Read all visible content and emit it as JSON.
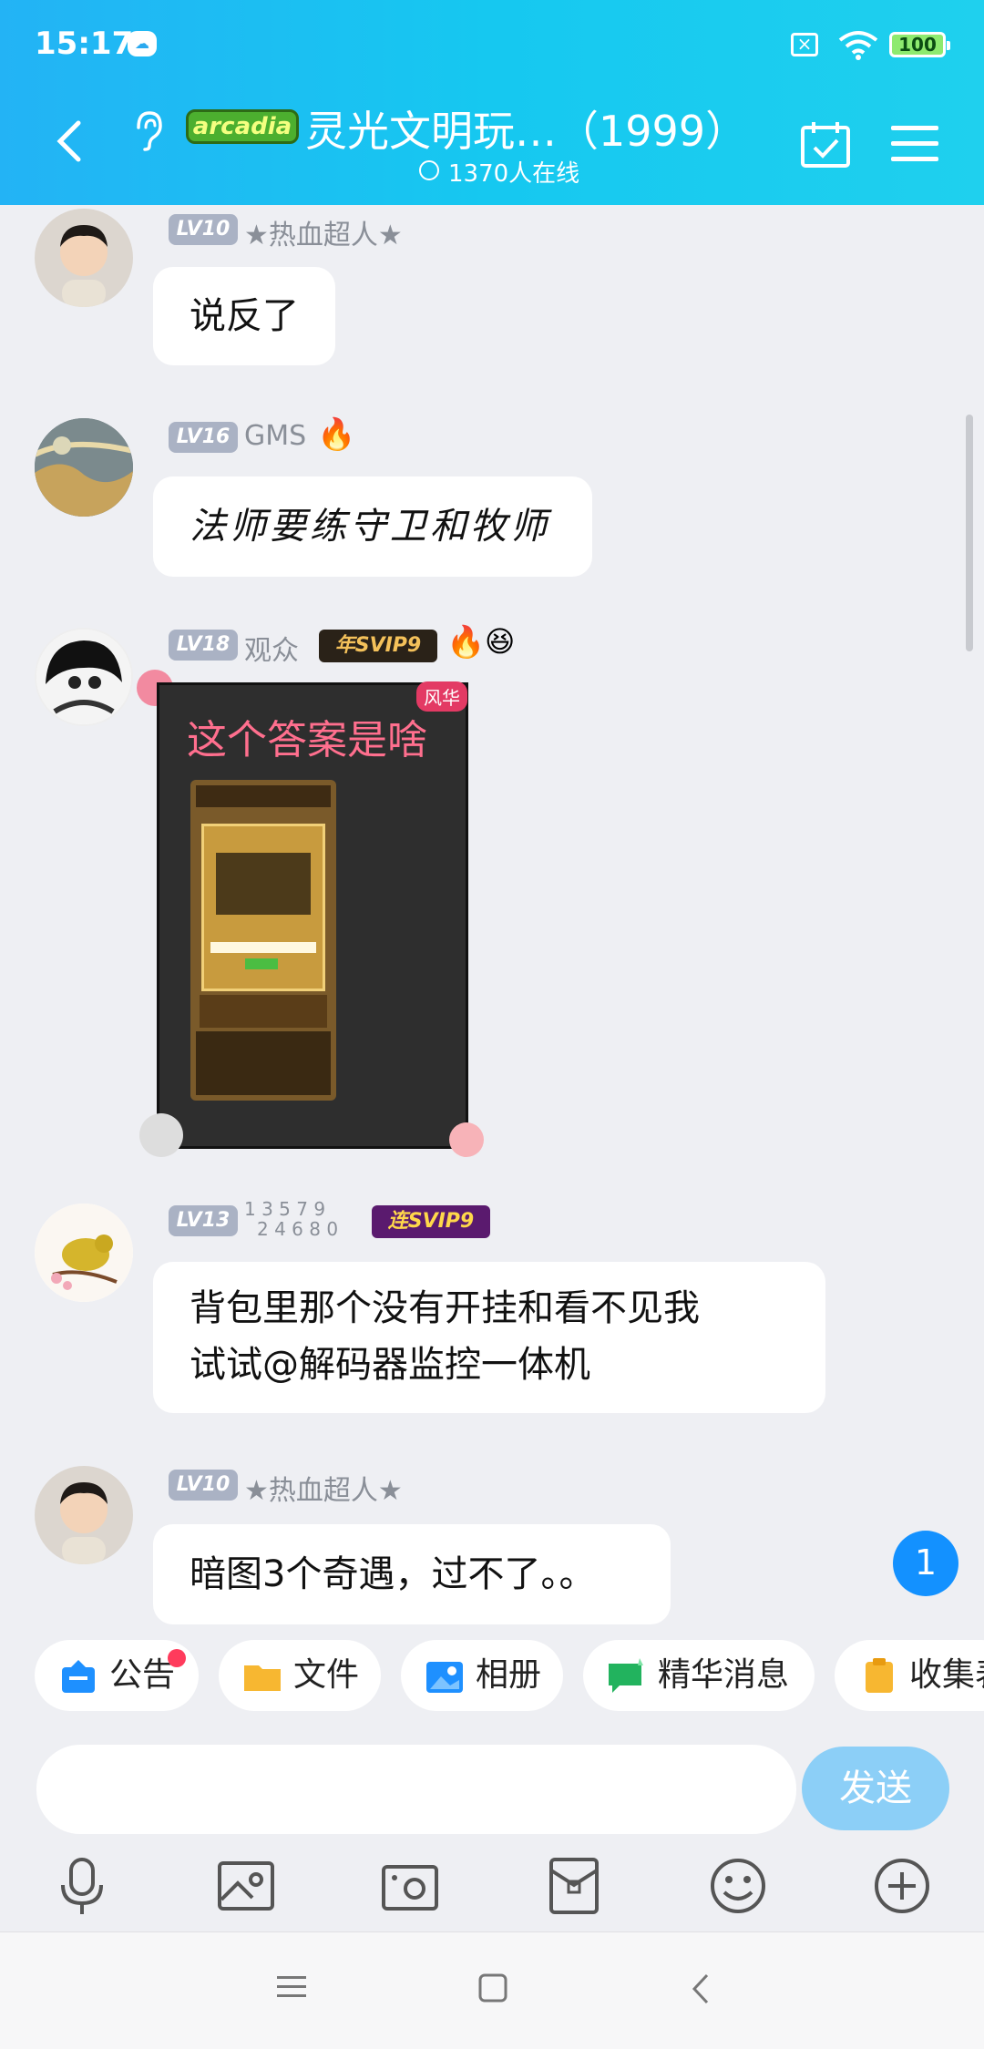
{
  "status": {
    "time": "15:17",
    "battery": "100"
  },
  "header": {
    "group_badge": "arcadia",
    "title": "灵光文明玩…（1999）",
    "online": "1370人在线"
  },
  "messages": [
    {
      "level": "LV10",
      "nick": "★热血超人★",
      "text": "说反了"
    },
    {
      "level": "LV16",
      "nick": "GMS",
      "text": "法师要练守卫和牧师"
    },
    {
      "level": "LV18",
      "nick": "观众",
      "svip": "年SVIP9",
      "image_caption": "这个答案是啥",
      "image_tag": "风华"
    },
    {
      "level": "LV13",
      "nick_top": "1 3 5 7 9",
      "nick_bottom": "2 4 6 8 0",
      "svip": "连SVIP9",
      "text_line1": "背包里那个没有开挂和看不见我",
      "text_line2": "试试@解码器监控一体机"
    },
    {
      "level": "LV10",
      "nick": "★热血超人★",
      "text": "暗图3个奇遇，过不了。。"
    }
  ],
  "unread_count": "1",
  "shortcuts": [
    "公告",
    "文件",
    "相册",
    "精华消息",
    "收集表"
  ],
  "input": {
    "send_label": "发送",
    "placeholder": ""
  },
  "colors": {
    "header": "#1fc3f0",
    "send": "#8ccff7",
    "badge": "#1391ff"
  }
}
